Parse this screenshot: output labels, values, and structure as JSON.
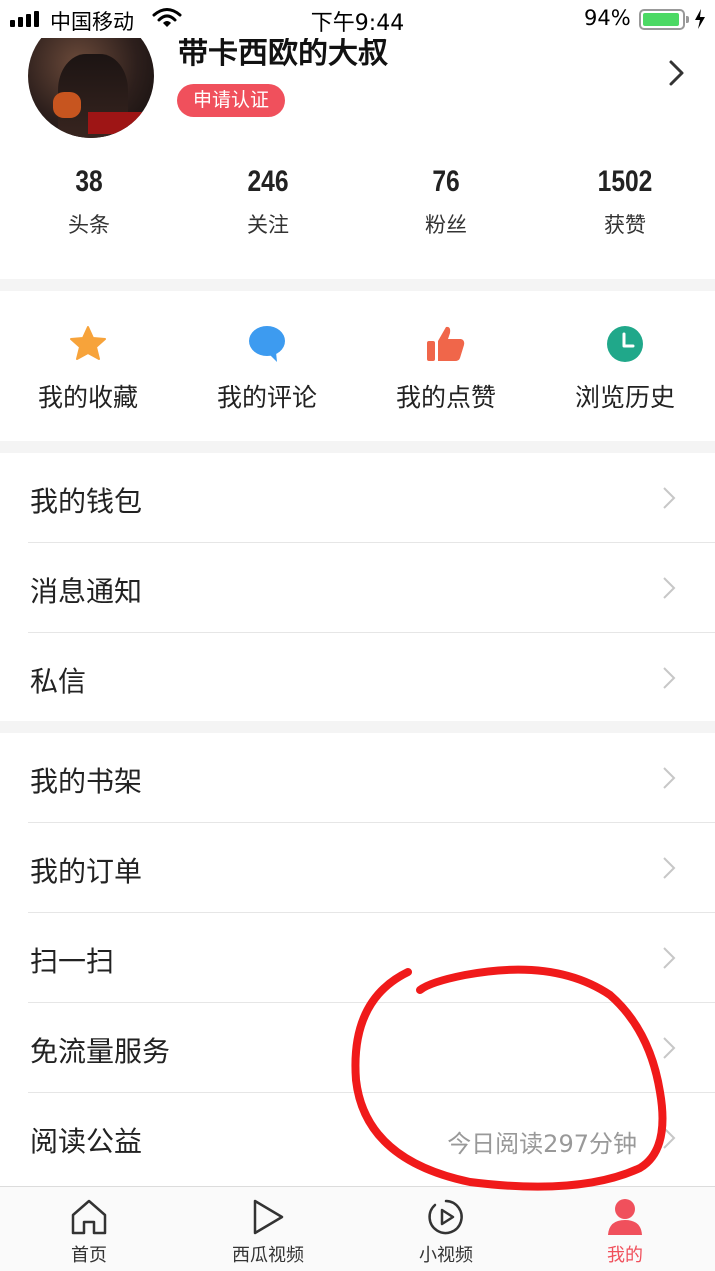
{
  "status_bar": {
    "carrier": "中国移动",
    "time": "下午9:44",
    "battery_pct": "94%",
    "battery_level": 0.94
  },
  "profile": {
    "username": "带卡西欧的大叔",
    "verify_label": "申请认证"
  },
  "stats": [
    {
      "value": "38",
      "label": "头条"
    },
    {
      "value": "246",
      "label": "关注"
    },
    {
      "value": "76",
      "label": "粉丝"
    },
    {
      "value": "1502",
      "label": "获赞"
    }
  ],
  "quick_actions": [
    {
      "label": "我的收藏",
      "icon": "star-icon",
      "color": "#f7a33a"
    },
    {
      "label": "我的评论",
      "icon": "comment-icon",
      "color": "#3d9bf0"
    },
    {
      "label": "我的点赞",
      "icon": "thumbs-up-icon",
      "color": "#f0664a"
    },
    {
      "label": "浏览历史",
      "icon": "clock-icon",
      "color": "#20a88a"
    }
  ],
  "menu_group_1": [
    {
      "label": "我的钱包"
    },
    {
      "label": "消息通知"
    },
    {
      "label": "私信"
    }
  ],
  "menu_group_2": [
    {
      "label": "我的书架"
    },
    {
      "label": "我的订单"
    },
    {
      "label": "扫一扫"
    },
    {
      "label": "免流量服务"
    },
    {
      "label": "阅读公益",
      "value": "今日阅读297分钟"
    }
  ],
  "tab_bar": [
    {
      "label": "首页",
      "icon": "home-icon"
    },
    {
      "label": "西瓜视频",
      "icon": "play-icon"
    },
    {
      "label": "小视频",
      "icon": "short-video-icon"
    },
    {
      "label": "我的",
      "icon": "user-icon",
      "active": true
    }
  ],
  "colors": {
    "accent": "#f0505c",
    "annotation": "#f01a1a"
  }
}
